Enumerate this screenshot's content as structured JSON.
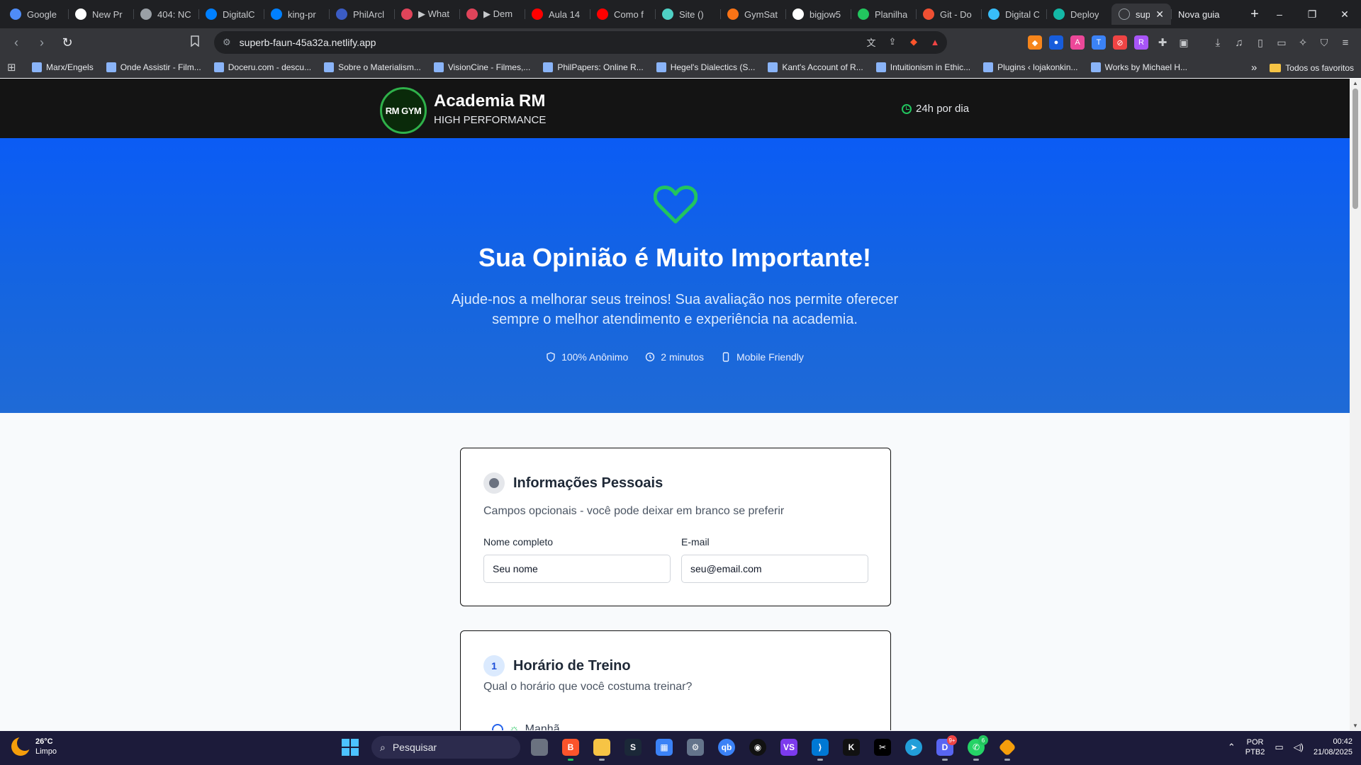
{
  "browser": {
    "tabs": [
      {
        "label": "Google",
        "icon": "gemini-icon",
        "color": "#4f8cf7"
      },
      {
        "label": "New Pr",
        "icon": "triangle-icon",
        "color": "#ffffff"
      },
      {
        "label": "404: NC",
        "icon": "globe-icon",
        "color": "#9aa0a6"
      },
      {
        "label": "DigitalC",
        "icon": "digitalocean-icon",
        "color": "#0080ff"
      },
      {
        "label": "king-pr",
        "icon": "digitalocean-icon",
        "color": "#0080ff"
      },
      {
        "label": "PhilArcl",
        "icon": "philpapers-icon",
        "color": "#3b5cc4"
      },
      {
        "label": "▶ What",
        "icon": "gitlens-icon",
        "color": "#e0445a"
      },
      {
        "label": "▶ Dem",
        "icon": "gitlens-icon",
        "color": "#e0445a"
      },
      {
        "label": "Aula 14",
        "icon": "youtube-icon",
        "color": "#ff0000"
      },
      {
        "label": "Como f",
        "icon": "youtube-icon",
        "color": "#ff0000"
      },
      {
        "label": "Site ()",
        "icon": "site-icon",
        "color": "#4fd1c5"
      },
      {
        "label": "GymSat",
        "icon": "gymsat-icon",
        "color": "#f97316"
      },
      {
        "label": "bigjow5",
        "icon": "github-icon",
        "color": "#ffffff"
      },
      {
        "label": "Planilha",
        "icon": "sheets-icon",
        "color": "#22c55e"
      },
      {
        "label": "Git - Do",
        "icon": "git-icon",
        "color": "#f05033"
      },
      {
        "label": "Digital C",
        "icon": "brain-icon",
        "color": "#38bdf8"
      },
      {
        "label": "Deploy",
        "icon": "deploy-icon",
        "color": "#14b8a6"
      }
    ],
    "active_tab": {
      "label": "sup",
      "close": "✕"
    },
    "new_tab": {
      "label": "Nova guia"
    },
    "new_tab_plus": "+",
    "window_controls": {
      "minimize": "–",
      "restore": "❐",
      "close": "✕"
    },
    "url": "superb-faun-45a32a.netlify.app",
    "bookmarks": [
      {
        "label": "Marx/Engels"
      },
      {
        "label": "Onde Assistir - Film..."
      },
      {
        "label": "Doceru.com - descu..."
      },
      {
        "label": "Sobre o Materialism..."
      },
      {
        "label": "VisionCine - Filmes,..."
      },
      {
        "label": "PhilPapers: Online R..."
      },
      {
        "label": "Hegel's Dialectics (S..."
      },
      {
        "label": "Kant's Account of R..."
      },
      {
        "label": "Intuitionism in Ethic..."
      },
      {
        "label": "Plugins ‹ lojakonkin..."
      },
      {
        "label": "Works by Michael H..."
      }
    ],
    "bookmarks_more": "»",
    "all_favorites": "Todos os favoritos"
  },
  "site": {
    "brand_name": "Academia RM",
    "brand_tagline": "HIGH PERFORMANCE",
    "logo_text": "RM GYM",
    "hours": "24h por dia"
  },
  "hero": {
    "title": "Sua Opinião é Muito Importante!",
    "subtitle": "Ajude-nos a melhorar seus treinos! Sua avaliação nos permite oferecer sempre o melhor atendimento e experiência na academia.",
    "features": [
      "100% Anônimo",
      "2 minutos",
      "Mobile Friendly"
    ]
  },
  "personal": {
    "title": "Informações Pessoais",
    "description": "Campos opcionais - você pode deixar em branco se preferir",
    "name_label": "Nome completo",
    "name_placeholder": "Seu nome",
    "email_label": "E-mail",
    "email_placeholder": "seu@email.com"
  },
  "schedule": {
    "number": "1",
    "title": "Horário de Treino",
    "question": "Qual o horário que você costuma treinar?",
    "first_option": "Manhã"
  },
  "taskbar": {
    "weather_temp": "26°C",
    "weather_desc": "Limpo",
    "search_placeholder": "Pesquisar",
    "lang_line1": "POR",
    "lang_line2": "PTB2",
    "time": "00:42",
    "date": "21/08/2025",
    "discord_badge": "9+",
    "whatsapp_badge": "6"
  },
  "colors": {
    "hero_blue": "#0b5cf5",
    "accent_green": "#22c55e",
    "header_bg": "#141414"
  }
}
